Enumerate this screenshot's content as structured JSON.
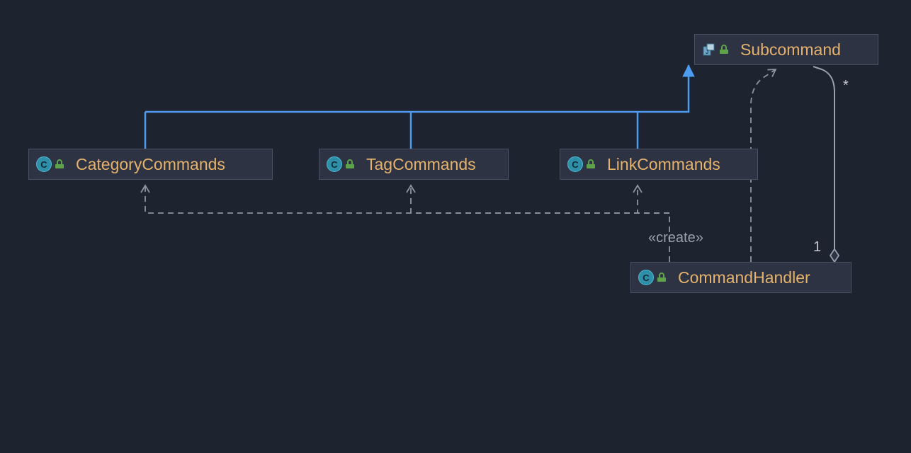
{
  "nodes": {
    "subcommand": {
      "label": "Subcommand",
      "kind": "interface"
    },
    "category": {
      "label": "CategoryCommands",
      "kind": "class"
    },
    "tag": {
      "label": "TagCommands",
      "kind": "class"
    },
    "link": {
      "label": "LinkCommands",
      "kind": "class"
    },
    "handler": {
      "label": "CommandHandler",
      "kind": "class"
    }
  },
  "relations": {
    "create_stereotype": "«create»",
    "aggregation": {
      "end1_mult": "1",
      "end2_mult": "*"
    }
  },
  "colors": {
    "bg": "#1e2330",
    "node_bg": "#2d3343",
    "node_border": "#4a5060",
    "label": "#e4b26c",
    "realization": "#4e9cef",
    "dependency": "#8d93a1",
    "association": "#9aa0ad"
  }
}
